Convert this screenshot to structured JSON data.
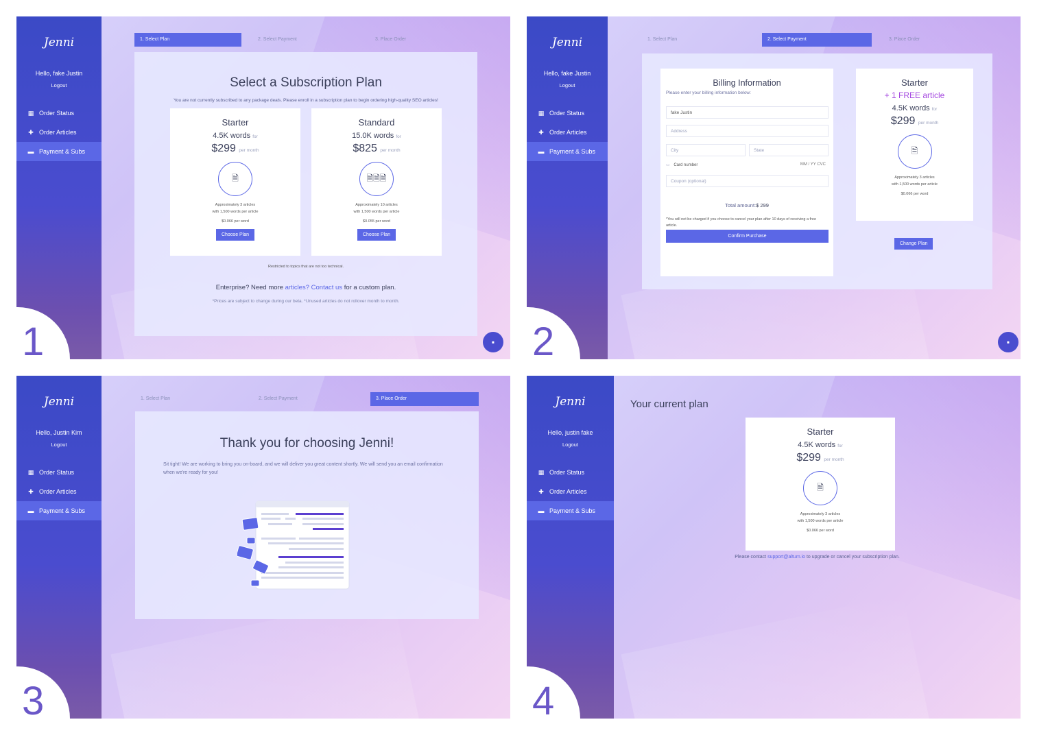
{
  "app": {
    "logo_text": "Jenni"
  },
  "panels": [
    {
      "number": "1",
      "hello": "Hello, fake Justin",
      "logout": "Logout",
      "nav": [
        {
          "label": "Order Status",
          "icon": "calendar-icon"
        },
        {
          "label": "Order Articles",
          "icon": "plus-icon"
        },
        {
          "label": "Payment & Subs",
          "icon": "card-icon"
        }
      ],
      "steps": [
        "1. Select Plan",
        "2. Select Payment",
        "3. Place Order"
      ],
      "active_step": 0,
      "title": "Select a Subscription Plan",
      "subtitle": "You are not currently subscribed to any package deals. Please enroll in a subscription plan to begin ordering high-quality SEO articles!",
      "plans": [
        {
          "name": "Starter",
          "words": "4.5K words",
          "for": "for",
          "price": "$299",
          "per": "per month",
          "icon": "document-icon",
          "desc1": "Approximately 3 articles",
          "desc2": "with 1,500 words per article",
          "rate": "$0.066 per word",
          "button": "Choose Plan"
        },
        {
          "name": "Standard",
          "words": "15.0K words",
          "for": "for",
          "price": "$825",
          "per": "per month",
          "icon": "documents-icon",
          "desc1": "Approximately 10 articles",
          "desc2": "with 1,500 words per article",
          "rate": "$0.055 per word",
          "button": "Choose Plan"
        }
      ],
      "restricted": "Restricted to topics that are not too technical.",
      "enterprise_prefix": "Enterprise? Need more ",
      "enterprise_articles": "articles?",
      "enterprise_contact": "Contact us",
      "enterprise_suffix": " for a custom plan.",
      "footnote": "*Prices are subject to change during our beta. *Unused articles do not rollover month to month."
    },
    {
      "number": "2",
      "hello": "Hello, fake Justin",
      "logout": "Logout",
      "nav": [
        {
          "label": "Order Status",
          "icon": "calendar-icon"
        },
        {
          "label": "Order Articles",
          "icon": "plus-icon"
        },
        {
          "label": "Payment & Subs",
          "icon": "card-icon"
        }
      ],
      "steps": [
        "1. Select Plan",
        "2. Select Payment",
        "3. Place Order"
      ],
      "active_step": 1,
      "billing_title": "Billing Information",
      "billing_sub": "Please enter your billing information below:",
      "name_value": "fake Justin",
      "address_placeholder": "Address",
      "city_placeholder": "City",
      "state_placeholder": "State",
      "card_placeholder": "Card number",
      "card_meta": "MM / YY  CVC",
      "coupon_placeholder": "Coupon (optional)",
      "total_label": "Total amount:",
      "total_value": "$ 299",
      "notice": "*You will not be charged if you choose to cancel your plan after 10 days of receiving a free article.",
      "confirm": "Confirm Purchase",
      "summary": {
        "name": "Starter",
        "bonus": "+ 1 FREE article",
        "words": "4.5K words",
        "for": "for",
        "price": "$299",
        "per": "per month",
        "icon": "document-icon",
        "desc1": "Approximately 3 articles",
        "desc2": "with 1,500 words per article",
        "rate": "$0.066 per word"
      },
      "change_plan": "Change Plan"
    },
    {
      "number": "3",
      "hello": "Hello, Justin Kim",
      "logout": "Logout",
      "nav": [
        {
          "label": "Order Status",
          "icon": "calendar-icon"
        },
        {
          "label": "Order Articles",
          "icon": "plus-icon"
        },
        {
          "label": "Payment & Subs",
          "icon": "card-icon"
        }
      ],
      "steps": [
        "1. Select Plan",
        "2. Select Payment",
        "3. Place Order"
      ],
      "active_step": 2,
      "title": "Thank you for choosing Jenni!",
      "message": "Sit tight! We are working to bring you on-board, and we will deliver you great content shortly. We will send you an email confirmation when we're ready for you!"
    },
    {
      "number": "4",
      "hello": "Hello, justin fake",
      "logout": "Logout",
      "nav": [
        {
          "label": "Order Status",
          "icon": "calendar-icon"
        },
        {
          "label": "Order Articles",
          "icon": "plus-icon"
        },
        {
          "label": "Payment & Subs",
          "icon": "card-icon"
        }
      ],
      "heading": "Your current plan",
      "plan": {
        "name": "Starter",
        "words": "4.5K words",
        "for": "for",
        "price": "$299",
        "per": "per month",
        "icon": "document-icon",
        "desc1": "Approximately 3 articles",
        "desc2": "with 1,500 words per article",
        "rate": "$0.066 per word"
      },
      "contact_prefix": "Please contact ",
      "contact_email": "support@altum.io",
      "contact_suffix": " to upgrade or cancel your subscription plan."
    }
  ],
  "colors": {
    "accent": "#5b67e6",
    "sidebar": "#3b4ac6",
    "number": "#6a57c8",
    "bonus": "#a64be0"
  }
}
